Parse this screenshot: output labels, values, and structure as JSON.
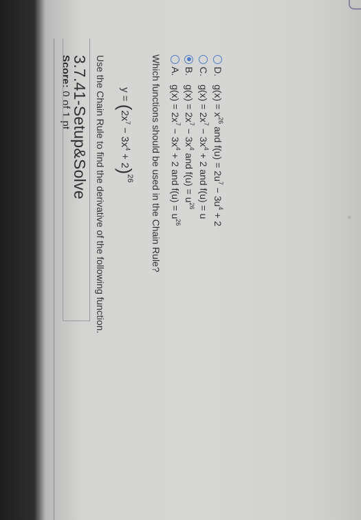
{
  "score": {
    "label": "Score:",
    "value": "0 of 1 pt"
  },
  "problem": {
    "title": "3.7.41-Setup&Solve",
    "instruction": "Use the Chain Rule to find the derivative of the following function.",
    "function": {
      "lhs": "y =",
      "open": "(",
      "t1": "2x",
      "e1": "7",
      "t2": " − 3x",
      "e2": "4",
      "t3": " + 2",
      "close": ")",
      "outer_exp": "26"
    },
    "question": "Which functions should be used in the Chain Rule?"
  },
  "options": [
    {
      "letter": "A.",
      "selected": false,
      "parts": [
        "g(x) = 2x",
        "7",
        " − 3x",
        "4",
        " + 2 and f(u) = u",
        "26"
      ]
    },
    {
      "letter": "B.",
      "selected": true,
      "parts": [
        "g(x) = 2x",
        "7",
        " − 3x",
        "4",
        " and f(u) = u",
        "26"
      ]
    },
    {
      "letter": "C.",
      "selected": false,
      "parts": [
        "g(x) = 2x",
        "7",
        " − 3x",
        "4",
        " + 2 and f(u) = u",
        ""
      ]
    },
    {
      "letter": "D.",
      "selected": false,
      "parts": [
        "g(x) = x",
        "26",
        " and f(u) = 2u",
        "7",
        " − 3u",
        "4",
        " + 2"
      ]
    }
  ],
  "colors": {
    "accent": "#4e7cc6",
    "text": "#2a2a2a"
  },
  "icons": {
    "corner": "refresh-icon"
  }
}
